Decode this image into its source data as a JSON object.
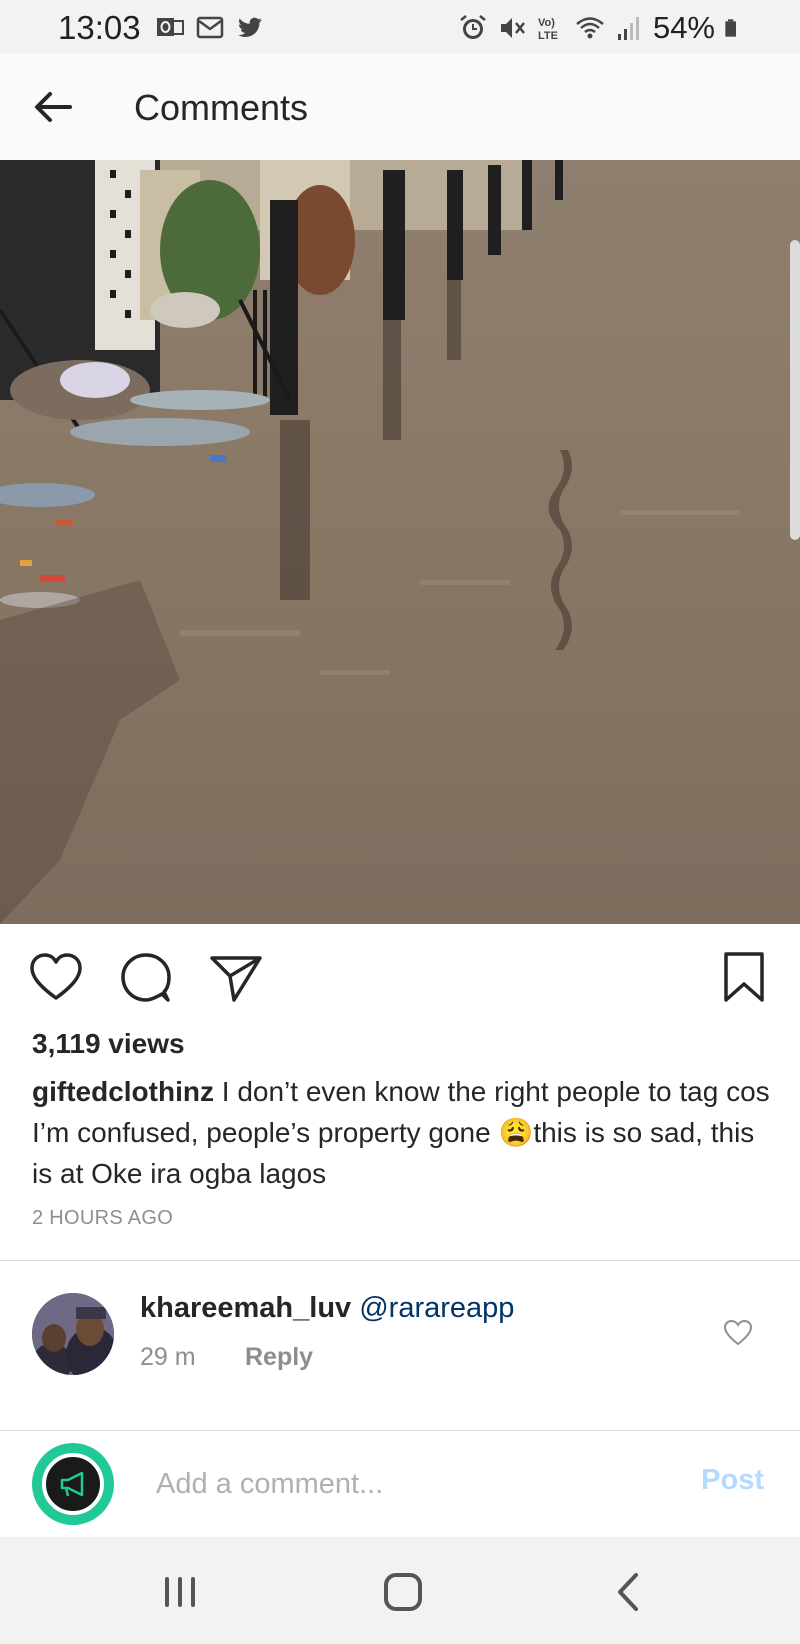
{
  "status_bar": {
    "time": "13:03",
    "left_icons": [
      "outlook-icon",
      "email-icon",
      "twitter-icon"
    ],
    "right_icons": [
      "alarm-icon",
      "mute-icon",
      "volte-icon",
      "wifi-icon",
      "signal-icon"
    ],
    "battery_percent": "54%"
  },
  "header": {
    "title": "Comments",
    "back_icon": "arrow-left-icon"
  },
  "post": {
    "image_icon": "flooded-street-photo",
    "actions": [
      "heart-icon",
      "comment-icon",
      "share-icon",
      "bookmark-icon"
    ],
    "views": "3,119 views",
    "caption_user": "giftedclothinz",
    "caption_text_1": " I don’t even know the right people to tag cos I’m confused, people’s property gone ",
    "caption_emoji": "😩",
    "caption_text_2": "this is so sad, this is at Oke ira ogba lagos",
    "time_ago": "2 HOURS AGO"
  },
  "comments": [
    {
      "username": "khareemah_luv",
      "mention": "@rarareapp",
      "time": "29 m",
      "reply_label": "Reply"
    }
  ],
  "composer": {
    "placeholder": "Add a comment...",
    "post_label": "Post"
  },
  "nav_bar": {
    "buttons": [
      "recents-icon",
      "home-icon",
      "back-icon"
    ]
  },
  "colors": {
    "mention": "#003569",
    "post_button_disabled": "#b3dbff",
    "muted_text": "#8e8e8e",
    "composer_avatar_ring": "#20c997"
  }
}
